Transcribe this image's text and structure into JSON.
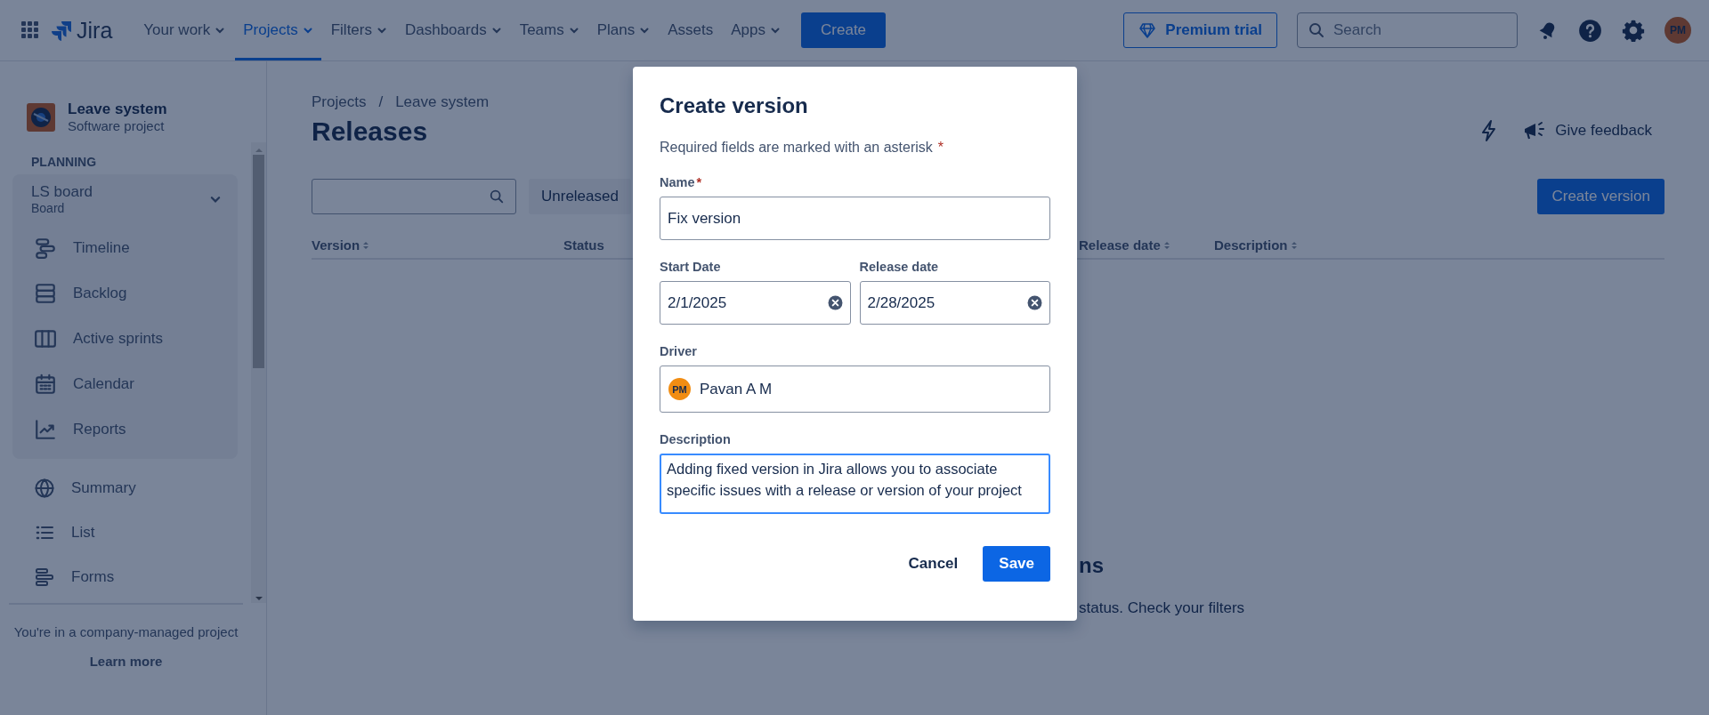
{
  "topnav": {
    "product": "Jira",
    "items": [
      {
        "label": "Your work",
        "dropdown": true,
        "selected": false
      },
      {
        "label": "Projects",
        "dropdown": true,
        "selected": true
      },
      {
        "label": "Filters",
        "dropdown": true,
        "selected": false
      },
      {
        "label": "Dashboards",
        "dropdown": true,
        "selected": false
      },
      {
        "label": "Teams",
        "dropdown": true,
        "selected": false
      },
      {
        "label": "Plans",
        "dropdown": true,
        "selected": false
      },
      {
        "label": "Assets",
        "dropdown": false,
        "selected": false
      },
      {
        "label": "Apps",
        "dropdown": true,
        "selected": false
      }
    ],
    "create": "Create",
    "premium": "Premium trial",
    "search": {
      "placeholder": "Search"
    },
    "avatar": "PM"
  },
  "sidebar": {
    "project": {
      "name": "Leave system",
      "type": "Software project"
    },
    "section": "PLANNING",
    "board": {
      "name": "LS board",
      "type": "Board",
      "expanded": true,
      "items": [
        {
          "label": "Timeline"
        },
        {
          "label": "Backlog"
        },
        {
          "label": "Active sprints"
        },
        {
          "label": "Calendar"
        },
        {
          "label": "Reports"
        }
      ]
    },
    "items": [
      {
        "label": "Summary"
      },
      {
        "label": "List"
      },
      {
        "label": "Forms"
      }
    ],
    "footer": {
      "text": "You're in a company-managed project",
      "link": "Learn more"
    }
  },
  "main": {
    "breadcrumb": [
      "Projects",
      "Leave system"
    ],
    "breadcrumb_separator": "/",
    "title": "Releases",
    "filter": "Unreleased",
    "feedback": "Give feedback",
    "create_version": "Create version",
    "columns": [
      {
        "label": "Version",
        "sortable": true
      },
      {
        "label": "Status",
        "sortable": false
      },
      {
        "label": "Release date",
        "sortable": true
      },
      {
        "label": "Description",
        "sortable": true
      }
    ],
    "empty_state": {
      "heading": "ns",
      "text": "status. Check your filters"
    }
  },
  "modal": {
    "title": "Create version",
    "required_note": "Required fields are marked with an asterisk",
    "required_mark": "*",
    "fields": [
      {
        "kind": "text",
        "label": "Name",
        "required": true,
        "value": "Fix version"
      },
      {
        "kind": "date",
        "label": "Start Date",
        "required": false,
        "value": "2/1/2025"
      },
      {
        "kind": "date",
        "label": "Release date",
        "required": false,
        "value": "2/28/2025"
      },
      {
        "kind": "user",
        "label": "Driver",
        "required": false,
        "value": "Pavan A M",
        "initials": "PM"
      },
      {
        "kind": "textarea",
        "label": "Description",
        "required": false,
        "focused": true,
        "value": "Adding fixed version in Jira allows you to associate specific issues with a release or version of your project"
      }
    ],
    "buttons": [
      {
        "label": "Cancel",
        "kind": "subtle"
      },
      {
        "label": "Save",
        "kind": "primary"
      }
    ]
  }
}
